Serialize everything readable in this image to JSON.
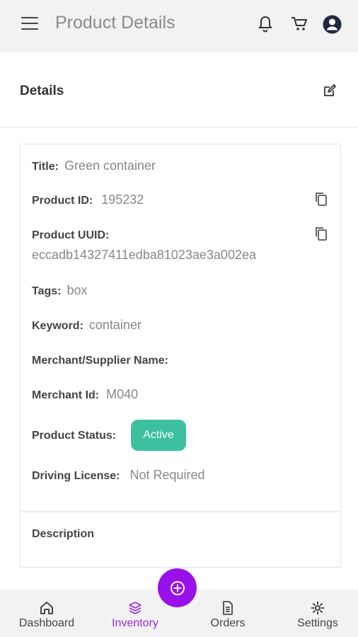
{
  "appbar": {
    "title": "Product Details",
    "icons": [
      "menu-icon",
      "bell-icon",
      "cart-icon",
      "account-icon"
    ]
  },
  "section": {
    "title": "Details",
    "edit_icon": "edit-icon"
  },
  "details": {
    "title_label": "Title:",
    "title_value": "Green container",
    "product_id_label": "Product ID:",
    "product_id_value": "195232",
    "uuid_label": "Product UUID:",
    "uuid_value": "eccadb14327411edba81023ae3a002ea",
    "tags_label": "Tags:",
    "tags_value": "box",
    "keyword_label": "Keyword:",
    "keyword_value": "container",
    "merchant_name_label": "Merchant/Supplier Name:",
    "merchant_id_label": "Merchant Id:",
    "merchant_id_value": "M040",
    "status_label": "Product Status:",
    "status_value": "Active",
    "license_label": "Driving License:",
    "license_value": "Not Required",
    "description_label": "Description"
  },
  "colors": {
    "accent": "#9a10e8",
    "status_active": "#3dbfa0",
    "appbar_bg": "#f2f2f2"
  },
  "bottom_nav": {
    "items": [
      {
        "label": "Dashboard",
        "icon": "home-icon",
        "active": false
      },
      {
        "label": "Inventory",
        "icon": "inventory-icon",
        "active": true
      },
      {
        "label": "Orders",
        "icon": "orders-icon",
        "active": false
      },
      {
        "label": "Settings",
        "icon": "settings-icon",
        "active": false
      }
    ],
    "fab_icon": "add-circle-icon"
  }
}
